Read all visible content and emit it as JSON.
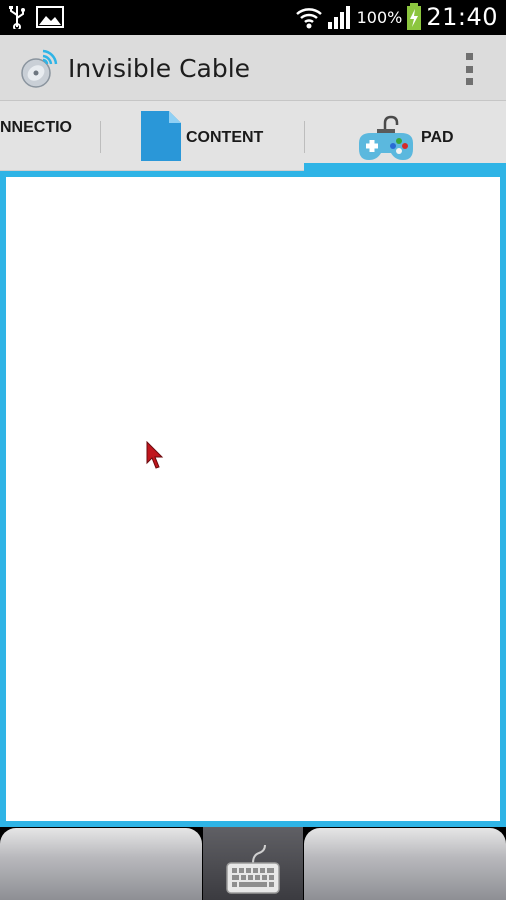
{
  "status_bar": {
    "battery_percent": "100%",
    "time": "21:40",
    "icons": [
      "usb-icon",
      "image-notification-icon",
      "wifi-icon",
      "signal-icon",
      "battery-charging-icon"
    ]
  },
  "action_bar": {
    "title": "Invisible Cable",
    "icon": "satellite-dish-icon",
    "overflow_icon": "overflow-menu-icon"
  },
  "tabs": [
    {
      "label": "NNECTIO",
      "icon": "",
      "selected": false
    },
    {
      "label": "CONTENT",
      "icon": "document-icon",
      "selected": false
    },
    {
      "label": "PAD",
      "icon": "gamepad-icon",
      "selected": true
    }
  ],
  "colors": {
    "accent": "#2fb4e6",
    "action_bar_bg": "#dcdcdc",
    "tab_bar_bg": "#e3e3e3",
    "cursor": "#c0161d"
  },
  "bottom_bar": {
    "left_button": "mouse-left-button",
    "center_icon": "keyboard-icon",
    "right_button": "mouse-right-button"
  }
}
